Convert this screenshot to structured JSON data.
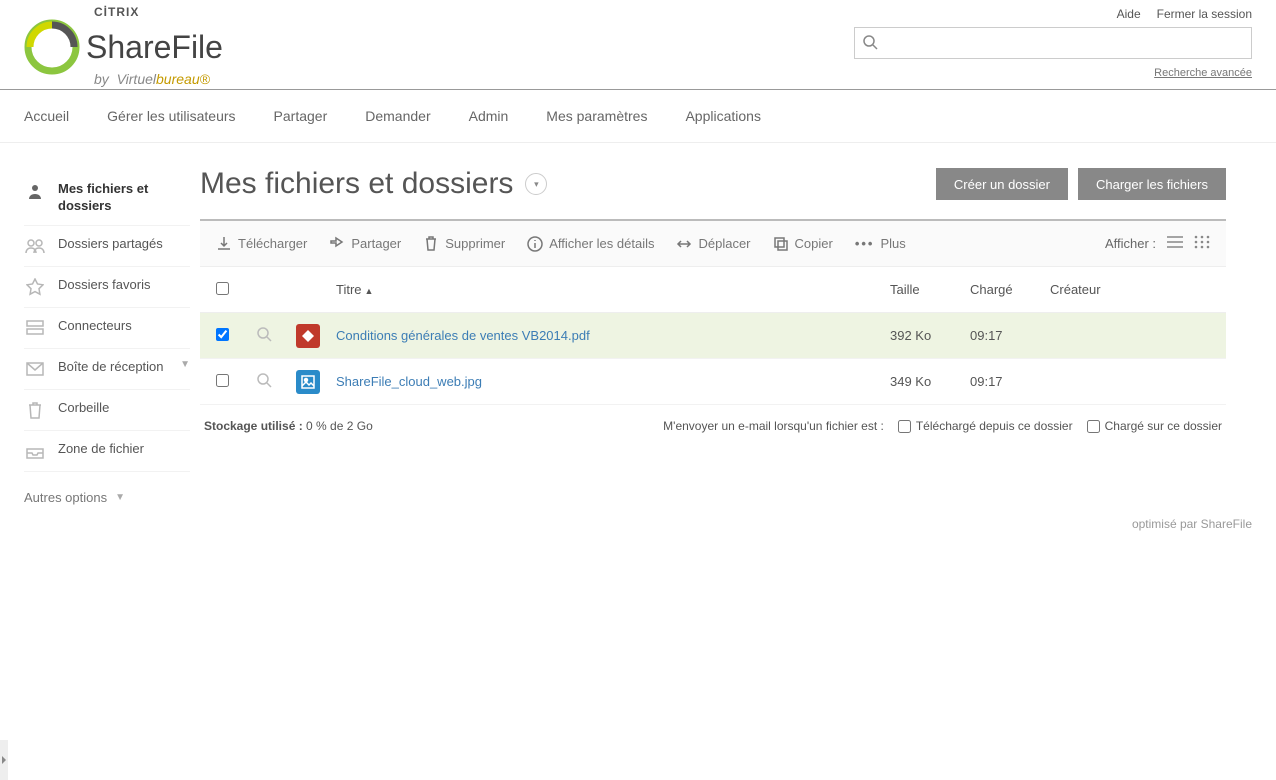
{
  "header": {
    "citrix": "CİTRIX",
    "brand_share": "Share",
    "brand_file": "File",
    "by": "by",
    "virtuel": "Virtuel",
    "bureau": "bureau®",
    "help": "Aide",
    "logout": "Fermer la session",
    "search_placeholder": "",
    "adv_search": "Recherche avancée"
  },
  "nav": {
    "home": "Accueil",
    "manage_users": "Gérer les utilisateurs",
    "share": "Partager",
    "request": "Demander",
    "admin": "Admin",
    "settings": "Mes paramètres",
    "apps": "Applications"
  },
  "sidebar": {
    "my_files": "Mes fichiers et dossiers",
    "shared": "Dossiers partagés",
    "favorites": "Dossiers favoris",
    "connectors": "Connecteurs",
    "inbox": "Boîte de réception",
    "trash": "Corbeille",
    "file_zone": "Zone de fichier",
    "other": "Autres options"
  },
  "page": {
    "title": "Mes fichiers et dossiers",
    "create_folder": "Créer un dossier",
    "upload_files": "Charger les fichiers"
  },
  "toolbar": {
    "download": "Télécharger",
    "share": "Partager",
    "delete": "Supprimer",
    "details": "Afficher les détails",
    "move": "Déplacer",
    "copy": "Copier",
    "more": "Plus",
    "display": "Afficher :"
  },
  "table": {
    "title": "Titre",
    "size": "Taille",
    "loaded": "Chargé",
    "creator": "Créateur"
  },
  "files": [
    {
      "name": "Conditions générales de ventes VB2014.pdf",
      "size": "392 Ko",
      "loaded": "09:17",
      "creator": "",
      "type": "pdf",
      "checked": true
    },
    {
      "name": "ShareFile_cloud_web.jpg",
      "size": "349 Ko",
      "loaded": "09:17",
      "creator": "",
      "type": "img",
      "checked": false
    }
  ],
  "footer": {
    "storage_label": "Stockage utilisé :",
    "storage_value": "0 % de 2 Go",
    "email_label": "M'envoyer un e-mail lorsqu'un fichier est :",
    "downloaded": "Téléchargé depuis ce dossier",
    "uploaded": "Chargé sur ce dossier",
    "powered": "optimisé par ShareFile"
  }
}
